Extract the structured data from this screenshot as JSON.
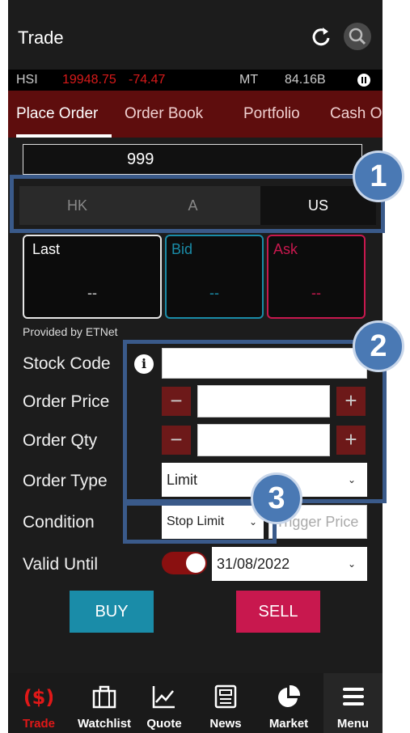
{
  "header": {
    "title": "Trade"
  },
  "ticker": {
    "index_name": "HSI",
    "index_value": "19948.75",
    "index_change": "-74.47",
    "turnover_label": "MT",
    "turnover_value": "84.16B"
  },
  "tabs": [
    {
      "label": "Place Order",
      "active": true
    },
    {
      "label": "Order Book"
    },
    {
      "label": "Portfolio"
    },
    {
      "label": "Cash O"
    }
  ],
  "account": {
    "value": "999"
  },
  "markets": [
    {
      "label": "HK"
    },
    {
      "label": "A"
    },
    {
      "label": "US",
      "active": true
    }
  ],
  "prices": {
    "last": {
      "label": "Last",
      "value": "--"
    },
    "bid": {
      "label": "Bid",
      "value": "--"
    },
    "ask": {
      "label": "Ask",
      "value": "--"
    }
  },
  "provided_by": "Provided by ETNet",
  "form": {
    "stock_code_label": "Stock Code",
    "order_price_label": "Order Price",
    "order_qty_label": "Order Qty",
    "order_type_label": "Order Type",
    "order_type_value": "Limit",
    "condition_label": "Condition",
    "condition_value": "Stop Limit",
    "trigger_price_placeholder": "Trigger Price",
    "valid_until_label": "Valid Until",
    "valid_until_value": "31/08/2022",
    "minus": "−",
    "plus": "+"
  },
  "actions": {
    "buy": "BUY",
    "sell": "SELL"
  },
  "bottom_nav": [
    {
      "label": "Trade",
      "icon": "trade-icon",
      "active": true
    },
    {
      "label": "Watchlist",
      "icon": "briefcase-icon"
    },
    {
      "label": "Quote",
      "icon": "chart-icon"
    },
    {
      "label": "News",
      "icon": "news-icon"
    },
    {
      "label": "Market",
      "icon": "pie-chart-icon"
    },
    {
      "label": "Menu",
      "icon": "menu-icon"
    }
  ],
  "callouts": [
    "1",
    "2",
    "3"
  ],
  "colors": {
    "accent_red": "#5e0d0d",
    "buy": "#1a8ca8",
    "sell": "#c8184e",
    "callout": "#4a79b4"
  }
}
